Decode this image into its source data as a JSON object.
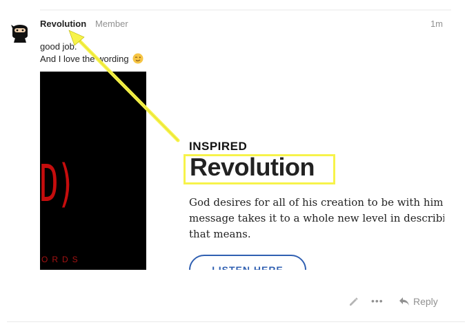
{
  "post": {
    "username": "Revolution",
    "user_title": "Member",
    "date": "1m",
    "body_line1": "good job.",
    "body_line2": "And I love the wording",
    "emoji": "winking-face-emoji"
  },
  "onebox": {
    "cover_text": "ED)",
    "cover_subtext": "ORDS",
    "kicker": "INSPIRED",
    "title": "Revolution",
    "description_lines": [
      "God desires for all of his creation to be with him.",
      "message takes it to a whole new level in describin",
      "that means."
    ],
    "button_label": "LISTEN HERE"
  },
  "actions": {
    "edit_icon": "pencil-icon",
    "more_icon": "ellipsis-icon",
    "reply_label": "Reply"
  },
  "annotation": {
    "arrow_color": "#f7f34a",
    "highlight_color": "#f7f34a"
  },
  "colors": {
    "link_blue": "#2f5fb1",
    "muted_gray": "#919191",
    "cover_red": "#c50d0d"
  }
}
